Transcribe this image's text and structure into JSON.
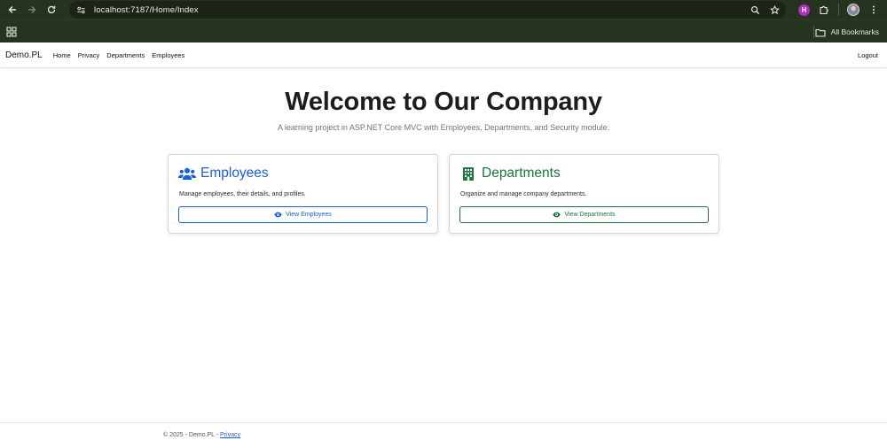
{
  "browser": {
    "url": "localhost:7187/Home/Index",
    "extension_badge": "H",
    "bookmarks_label": "All Bookmarks"
  },
  "navbar": {
    "brand": "Demo.PL",
    "links": [
      "Home",
      "Privacy",
      "Departments",
      "Employees"
    ],
    "logout": "Logout"
  },
  "hero": {
    "title": "Welcome to Our Company",
    "subtitle": "A learning project in ASP.NET Core MVC with Employees, Departments, and Security module."
  },
  "cards": [
    {
      "icon": "users-icon",
      "title": "Employees",
      "text": "Manage employees, their details, and profiles.",
      "button": "View Employees",
      "color": "#1a5fd6"
    },
    {
      "icon": "building-icon",
      "title": "Departments",
      "text": "Organize and manage company departments.",
      "button": "View Departments",
      "color": "#1a7442"
    }
  ],
  "footer": {
    "text": "© 2025 - Demo.PL - ",
    "link": "Privacy"
  }
}
